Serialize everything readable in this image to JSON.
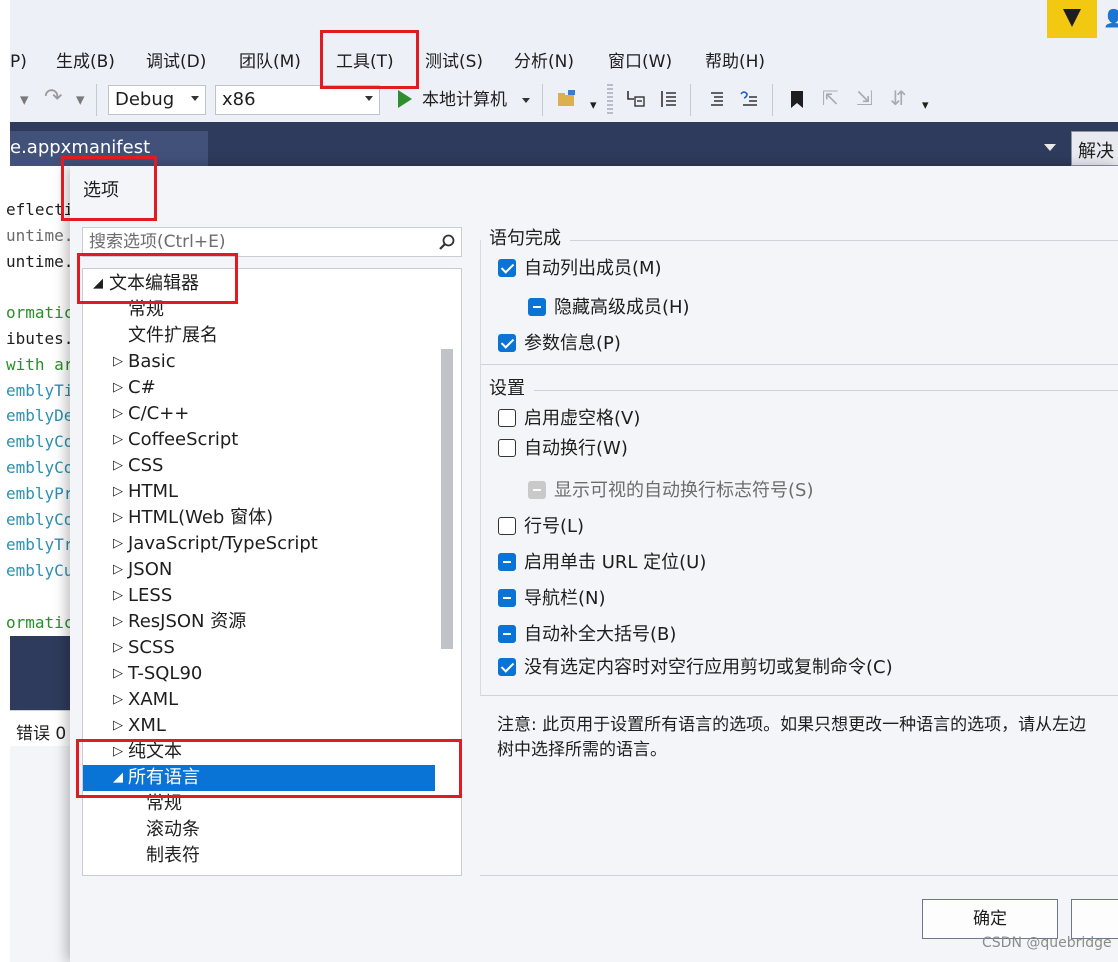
{
  "menubar": {
    "items": [
      "P)",
      "生成(B)",
      "调试(D)",
      "团队(M)",
      "工具(T)",
      "测试(S)",
      "分析(N)",
      "窗口(W)",
      "帮助(H)"
    ]
  },
  "toolbar": {
    "config": "Debug",
    "platform": "x86",
    "run_label": "本地计算机"
  },
  "tabs": {
    "document": "e.appxmanifest",
    "solution_explorer": "解决"
  },
  "code_lines": [
    "eflecti",
    "untime.",
    "untime.",
    "",
    "ormatic",
    "ibutes.",
    "with ar",
    "emblyTi",
    "emblyDe",
    "emblyCo",
    "emblyCo",
    "emblyPr",
    "emblyCo",
    "emblyTr",
    "emblyCu",
    "",
    "ormatic"
  ],
  "error_list": {
    "label": "错误 0"
  },
  "dialog": {
    "title": "选项",
    "search_placeholder": "搜索选项(Ctrl+E)",
    "tree": [
      {
        "label": "文本编辑器",
        "level": 0,
        "state": "expanded",
        "selected": false
      },
      {
        "label": "常规",
        "level": 1,
        "state": "leaf",
        "selected": false
      },
      {
        "label": "文件扩展名",
        "level": 1,
        "state": "leaf",
        "selected": false
      },
      {
        "label": "Basic",
        "level": 1,
        "state": "collapsed",
        "selected": false
      },
      {
        "label": "C#",
        "level": 1,
        "state": "collapsed",
        "selected": false
      },
      {
        "label": "C/C++",
        "level": 1,
        "state": "collapsed",
        "selected": false
      },
      {
        "label": "CoffeeScript",
        "level": 1,
        "state": "collapsed",
        "selected": false
      },
      {
        "label": "CSS",
        "level": 1,
        "state": "collapsed",
        "selected": false
      },
      {
        "label": "HTML",
        "level": 1,
        "state": "collapsed",
        "selected": false
      },
      {
        "label": "HTML(Web 窗体)",
        "level": 1,
        "state": "collapsed",
        "selected": false
      },
      {
        "label": "JavaScript/TypeScript",
        "level": 1,
        "state": "collapsed",
        "selected": false
      },
      {
        "label": "JSON",
        "level": 1,
        "state": "collapsed",
        "selected": false
      },
      {
        "label": "LESS",
        "level": 1,
        "state": "collapsed",
        "selected": false
      },
      {
        "label": "ResJSON 资源",
        "level": 1,
        "state": "collapsed",
        "selected": false
      },
      {
        "label": "SCSS",
        "level": 1,
        "state": "collapsed",
        "selected": false
      },
      {
        "label": "T-SQL90",
        "level": 1,
        "state": "collapsed",
        "selected": false
      },
      {
        "label": "XAML",
        "level": 1,
        "state": "collapsed",
        "selected": false
      },
      {
        "label": "XML",
        "level": 1,
        "state": "collapsed",
        "selected": false
      },
      {
        "label": "纯文本",
        "level": 1,
        "state": "collapsed",
        "selected": false
      },
      {
        "label": "所有语言",
        "level": 1,
        "state": "expanded",
        "selected": true
      },
      {
        "label": "常规",
        "level": 2,
        "state": "leaf",
        "selected": false
      },
      {
        "label": "滚动条",
        "level": 2,
        "state": "leaf",
        "selected": false
      },
      {
        "label": "制表符",
        "level": 2,
        "state": "leaf",
        "selected": false
      }
    ],
    "statement_completion": {
      "title": "语句完成",
      "options": [
        {
          "label": "自动列出成员(M)",
          "state": "checked",
          "indent": 0
        },
        {
          "label": "隐藏高级成员(H)",
          "state": "indeterminate",
          "indent": 1
        },
        {
          "label": "参数信息(P)",
          "state": "checked",
          "indent": 0
        }
      ]
    },
    "settings": {
      "title": "设置",
      "options": [
        {
          "label": "启用虚空格(V)",
          "state": "unchecked",
          "indent": 0
        },
        {
          "label": "自动换行(W)",
          "state": "unchecked",
          "indent": 0
        },
        {
          "label": "显示可视的自动换行标志符号(S)",
          "state": "disabled",
          "indent": 1
        },
        {
          "label": "行号(L)",
          "state": "unchecked",
          "indent": 0
        },
        {
          "label": "启用单击 URL 定位(U)",
          "state": "indeterminate",
          "indent": 0
        },
        {
          "label": "导航栏(N)",
          "state": "indeterminate",
          "indent": 0
        },
        {
          "label": "自动补全大括号(B)",
          "state": "indeterminate",
          "indent": 0
        },
        {
          "label": "没有选定内容时对空行应用剪切或复制命令(C)",
          "state": "checked",
          "indent": 0
        }
      ]
    },
    "note_line1": "注意: 此页用于设置所有语言的选项。如果只想更改一种语言的选项，请从左边",
    "note_line2": "树中选择所需的语言。",
    "ok_button": "确定"
  },
  "watermark": "CSDN @quebridge",
  "colors": {
    "accent": "#0a74d6",
    "highlight_box": "#e11b22",
    "tab_strip": "#2f3b5c",
    "chrome": "#eef0f7"
  }
}
